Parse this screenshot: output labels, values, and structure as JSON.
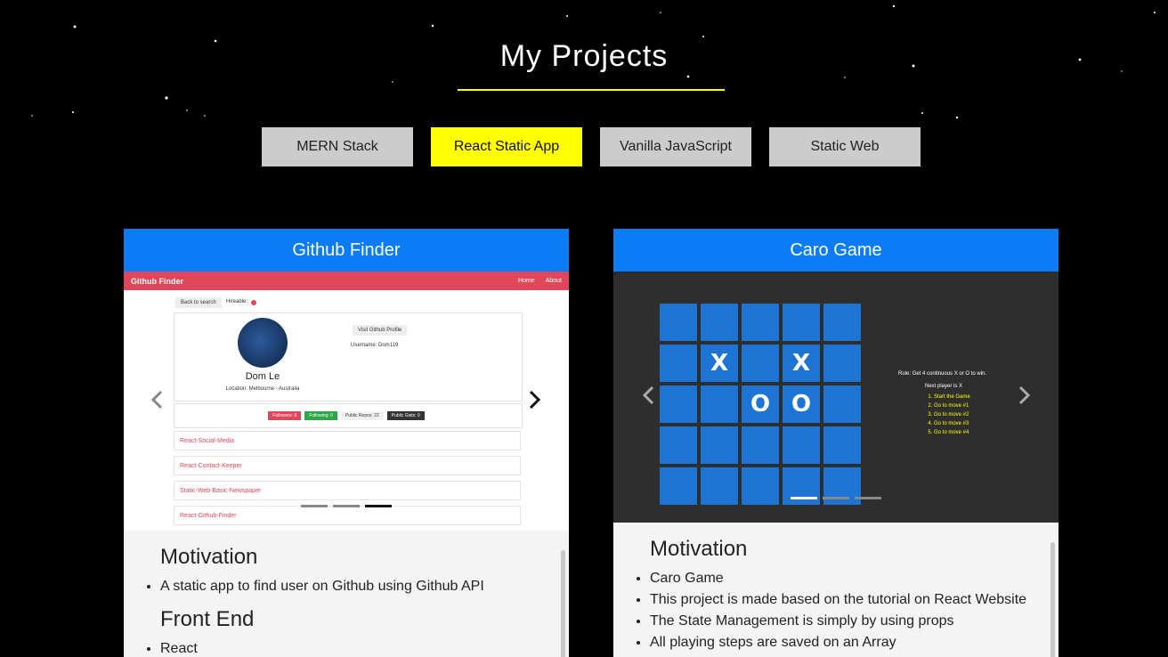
{
  "page": {
    "title": "My Projects",
    "accent": "#ffff00",
    "card_header_color": "#0b7cf5"
  },
  "filters": [
    {
      "label": "MERN Stack",
      "active": false
    },
    {
      "label": "React Static App",
      "active": true
    },
    {
      "label": "Vanilla JavaScript",
      "active": false
    },
    {
      "label": "Static Web",
      "active": false
    }
  ],
  "cards": [
    {
      "title": "Github Finder",
      "slide": {
        "nav_brand": "Github Finder",
        "nav_links": [
          "Home",
          "About"
        ],
        "back_button": "Back to search",
        "hireable": "Hireable:",
        "visit_button": "Visit Github Profile",
        "username": "Username: Dom119",
        "name": "Dom Le",
        "location": "Location: Melbourne - Australia",
        "badges": [
          "Followers: 8",
          "Following: 0",
          "Public Repos: 22",
          "Public Gists: 0"
        ],
        "repos": [
          "React-Social-Media",
          "React-Contact-Keeper",
          "Static-Web-Basic-Newspaper",
          "React-Github-Finder"
        ]
      },
      "carousel": {
        "prev_icon": "chevron-left-icon",
        "next_icon": "chevron-right-icon",
        "slides": 3,
        "active_index": 2
      },
      "sections": [
        {
          "heading": "Motivation",
          "items": [
            "A static app to find user on Github using Github API"
          ]
        },
        {
          "heading": "Front End",
          "items": [
            "React"
          ]
        }
      ]
    },
    {
      "title": "Caro Game",
      "slide": {
        "board": [
          [
            "",
            "",
            "",
            "",
            ""
          ],
          [
            "",
            "X",
            "",
            "X",
            ""
          ],
          [
            "",
            "",
            "O",
            "O",
            ""
          ],
          [
            "",
            "",
            "",
            "",
            ""
          ],
          [
            "",
            "",
            "",
            "",
            ""
          ]
        ],
        "rule": "Rule: Get 4 continuous X or O to win.",
        "next_player": "Next player is X",
        "moves": [
          "Start the Game",
          "Go to move #1",
          "Go to move #2",
          "Go to move #3",
          "Go to move #4"
        ]
      },
      "carousel": {
        "prev_icon": "chevron-left-icon",
        "next_icon": "chevron-right-icon",
        "slides": 3,
        "active_index": 0
      },
      "sections": [
        {
          "heading": "Motivation",
          "items": [
            "Caro Game",
            "This project is made based on the tutorial on React Website",
            "The State Management is simply by using props",
            "All playing steps are saved on an Array"
          ]
        }
      ]
    }
  ]
}
